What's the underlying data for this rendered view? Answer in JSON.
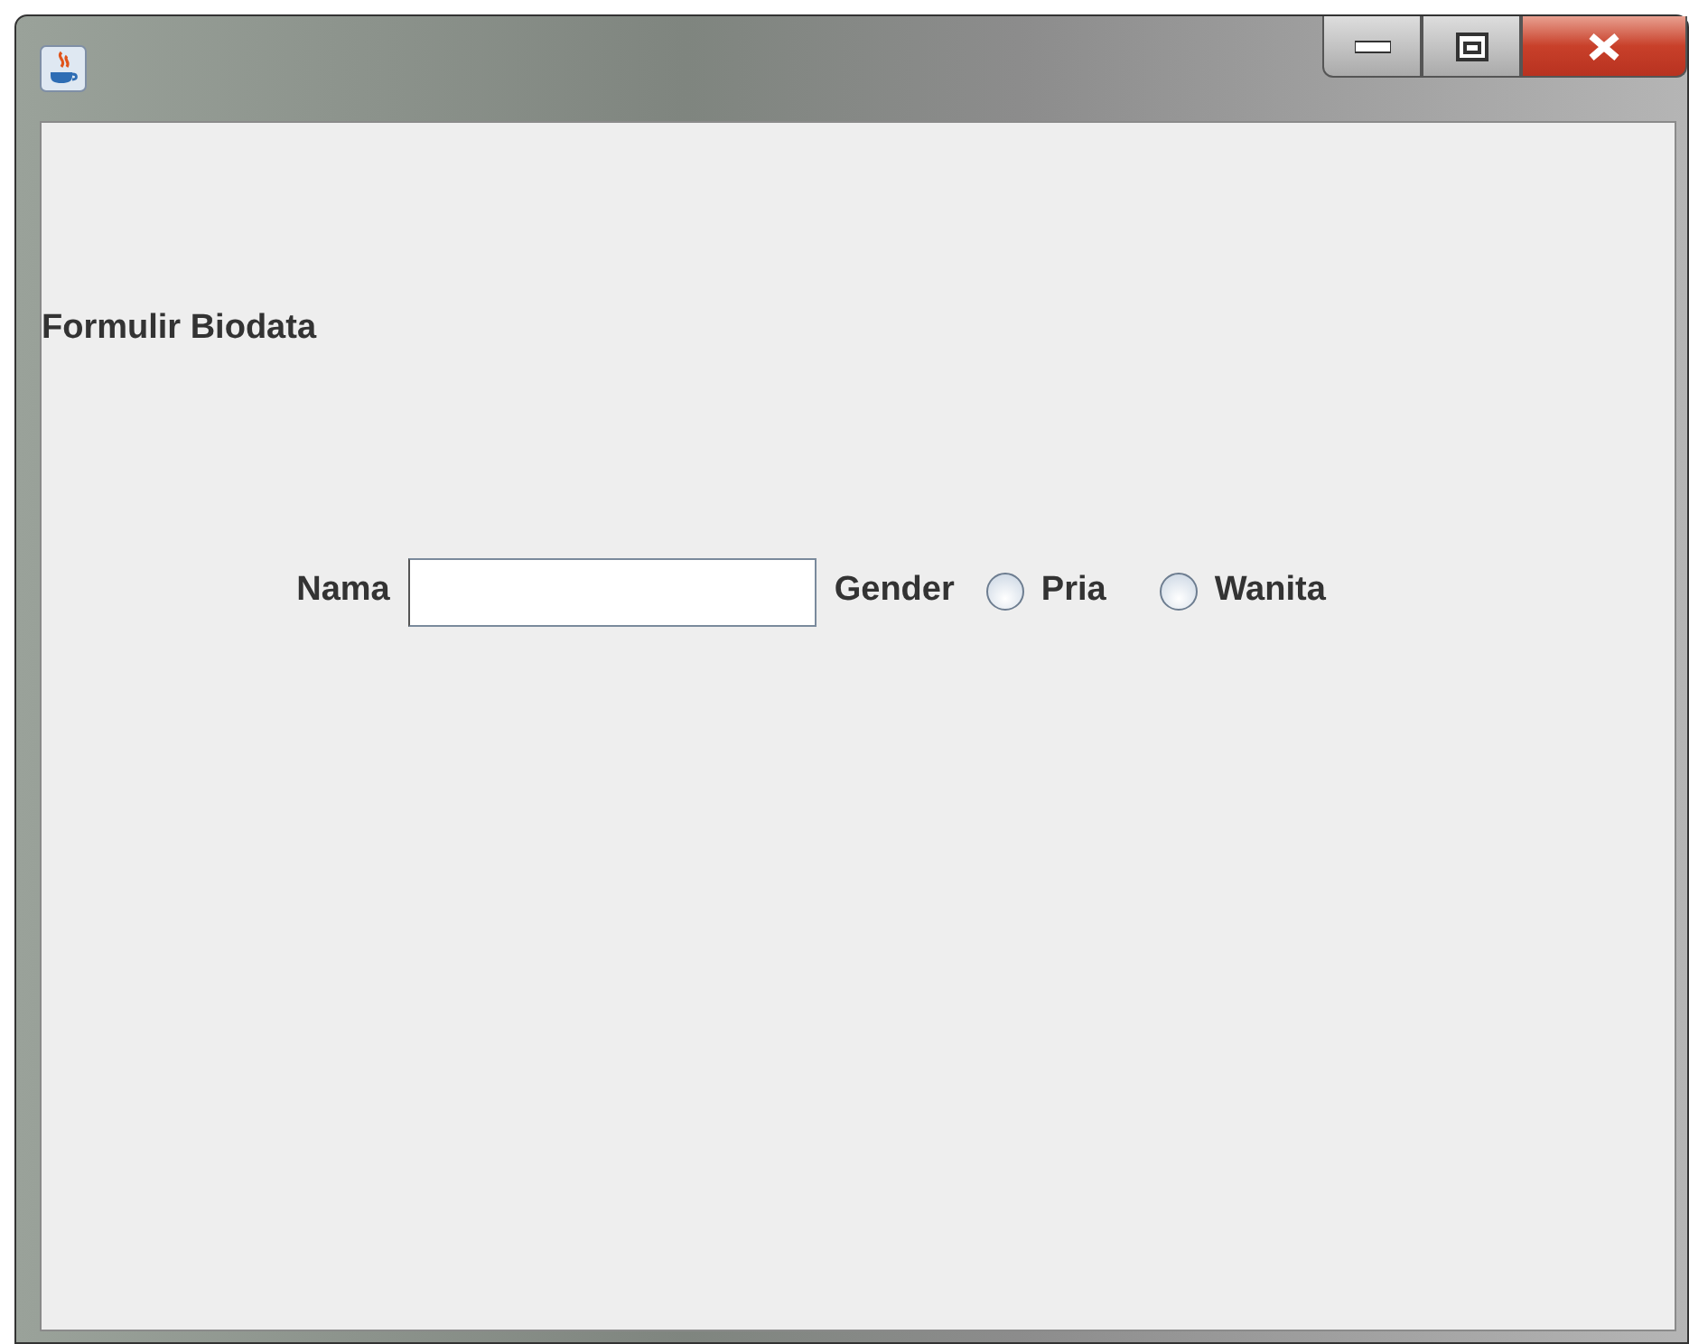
{
  "heading": "Formulir Biodata",
  "form": {
    "name_label": "Nama",
    "gender_label": "Gender",
    "options": [
      {
        "label": "Pria",
        "selected": false
      },
      {
        "label": "Wanita",
        "selected": false
      }
    ]
  }
}
